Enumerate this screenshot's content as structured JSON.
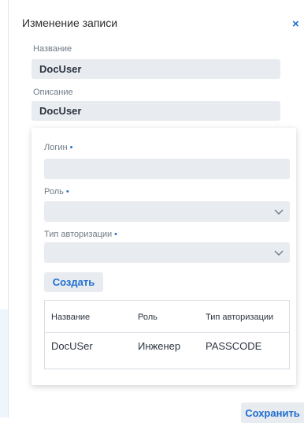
{
  "dialog": {
    "title": "Изменение записи",
    "close_glyph": "×"
  },
  "form": {
    "name_label": "Название",
    "name_value": "DocUser",
    "description_label": "Описание",
    "description_value": "DocUser"
  },
  "user_card": {
    "login_label": "Логин",
    "login_value": "",
    "role_label": "Роль",
    "role_value": "",
    "auth_label": "Тип авторизации",
    "auth_value": "",
    "required_mark": "•",
    "create_button": "Создать"
  },
  "table": {
    "columns": [
      "Название",
      "Роль",
      "Тип авторизации"
    ],
    "rows": [
      [
        "DocUSer",
        "Инженер",
        "PASSCODE"
      ]
    ]
  },
  "footer": {
    "save_button": "Сохранить"
  },
  "colors": {
    "accent": "#1f6fd1",
    "field_bg": "#e8ebef",
    "text": "#2c3440"
  },
  "icons": {
    "close": "close-icon",
    "dropdown": "chevron-down-icon"
  }
}
